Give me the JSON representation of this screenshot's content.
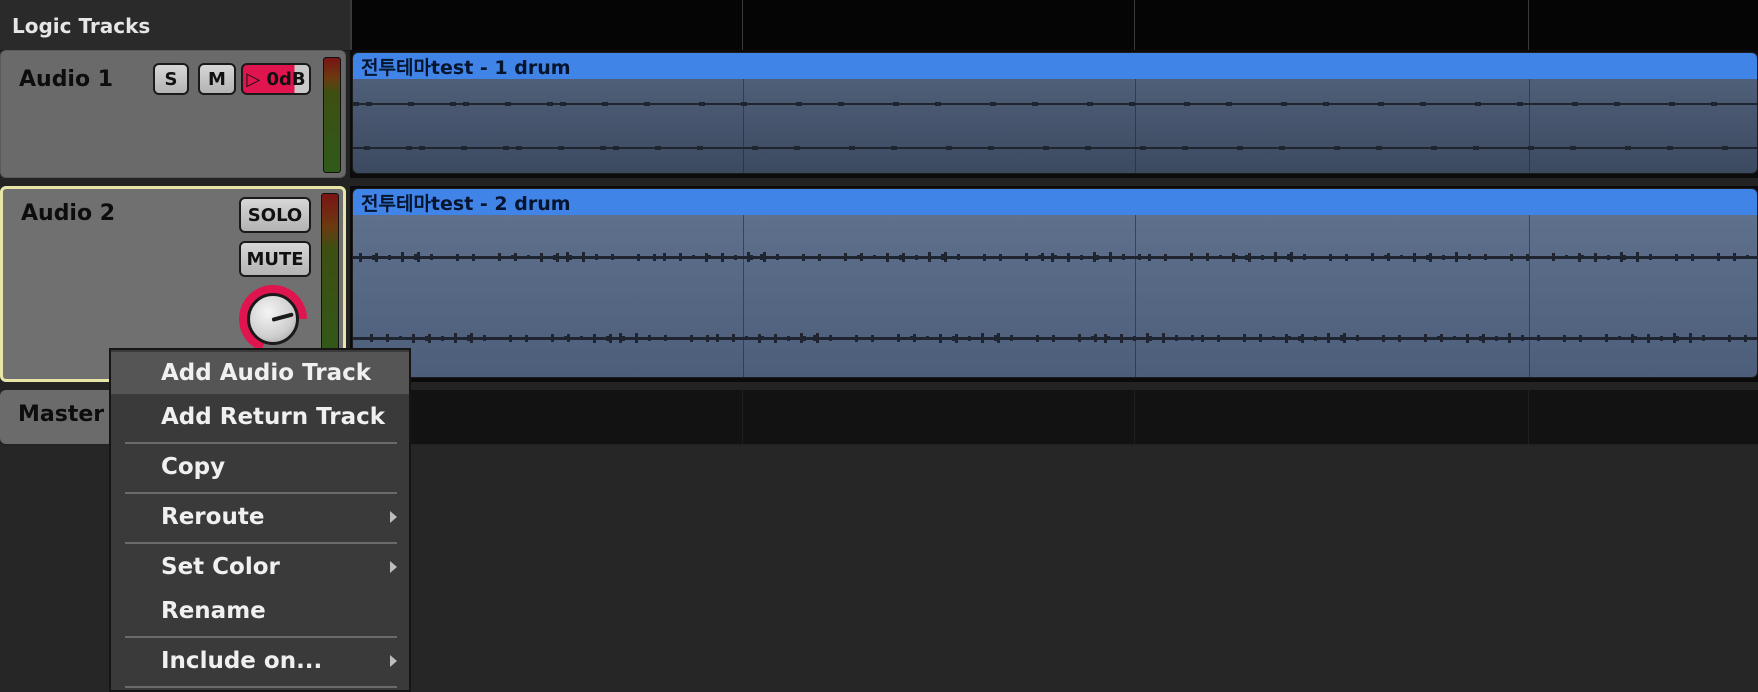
{
  "app": {
    "title": "Logic Tracks"
  },
  "tracks": [
    {
      "name": "Audio 1",
      "solo_label": "S",
      "mute_label": "M",
      "gain_label": "▷ 0dB",
      "clip_name": "전투테마test - 1 drum"
    },
    {
      "name": "Audio 2",
      "solo_label": "SOLO",
      "mute_label": "MUTE",
      "clip_name": "전투테마test - 2 drum"
    },
    {
      "name": "Master"
    }
  ],
  "context_menu": {
    "items": [
      {
        "label": "Add Audio Track",
        "submenu": false
      },
      {
        "label": "Add Return Track",
        "submenu": false
      },
      {
        "label": "Copy",
        "submenu": false
      },
      {
        "label": "Reroute",
        "submenu": true
      },
      {
        "label": "Set Color",
        "submenu": true
      },
      {
        "label": "Rename",
        "submenu": false
      },
      {
        "label": "Include on...",
        "submenu": true
      }
    ]
  },
  "colors": {
    "clip_header": "#3f84e6",
    "selected_border": "#e8e6a6",
    "gain_accent": "#e0144e",
    "menu_bg": "#3a3a3a"
  }
}
